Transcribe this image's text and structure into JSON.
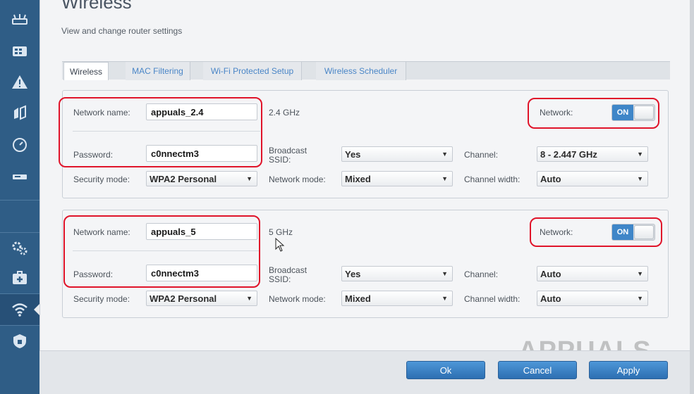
{
  "page": {
    "title": "Wireless",
    "subtitle": "View and change router settings"
  },
  "sidebar": {
    "items": [
      {
        "icon": "router-icon"
      },
      {
        "icon": "device-list-icon"
      },
      {
        "icon": "warning-icon"
      },
      {
        "icon": "connectivity-icon"
      },
      {
        "icon": "speed-test-icon"
      },
      {
        "icon": "external-storage-icon"
      },
      {
        "icon": "settings-gears-icon"
      },
      {
        "icon": "troubleshooting-icon"
      },
      {
        "icon": "wireless-icon",
        "active": true
      },
      {
        "icon": "security-shield-icon"
      }
    ]
  },
  "tabs": [
    {
      "label": "Wireless",
      "active": true
    },
    {
      "label": "MAC Filtering"
    },
    {
      "label": "Wi-Fi Protected Setup"
    },
    {
      "label": "Wireless Scheduler"
    }
  ],
  "band24": {
    "network_name_label": "Network name:",
    "network_name_value": "appuals_2.4",
    "band": "2.4 GHz",
    "network_label": "Network:",
    "network_toggle": "ON",
    "password_label": "Password:",
    "password_value": "c0nnectm3",
    "broadcast_label": "Broadcast SSID:",
    "broadcast_value": "Yes",
    "channel_label": "Channel:",
    "channel_value": "8 - 2.447 GHz",
    "security_label": "Security mode:",
    "security_value": "WPA2 Personal",
    "network_mode_label": "Network mode:",
    "network_mode_value": "Mixed",
    "channel_width_label": "Channel width:",
    "channel_width_value": "Auto"
  },
  "band5": {
    "network_name_label": "Network name:",
    "network_name_value": "appuals_5",
    "band": "5 GHz",
    "network_label": "Network:",
    "network_toggle": "ON",
    "password_label": "Password:",
    "password_value": "c0nnectm3",
    "broadcast_label": "Broadcast SSID:",
    "broadcast_value": "Yes",
    "channel_label": "Channel:",
    "channel_value": "Auto",
    "security_label": "Security mode:",
    "security_value": "WPA2 Personal",
    "network_mode_label": "Network mode:",
    "network_mode_value": "Mixed",
    "channel_width_label": "Channel width:",
    "channel_width_value": "Auto"
  },
  "footer": {
    "ok": "Ok",
    "cancel": "Cancel",
    "apply": "Apply"
  },
  "watermark": "APPUALS",
  "colors": {
    "sidebar": "#2f5d86",
    "accent": "#3f86c8",
    "highlight": "#e0142a"
  }
}
